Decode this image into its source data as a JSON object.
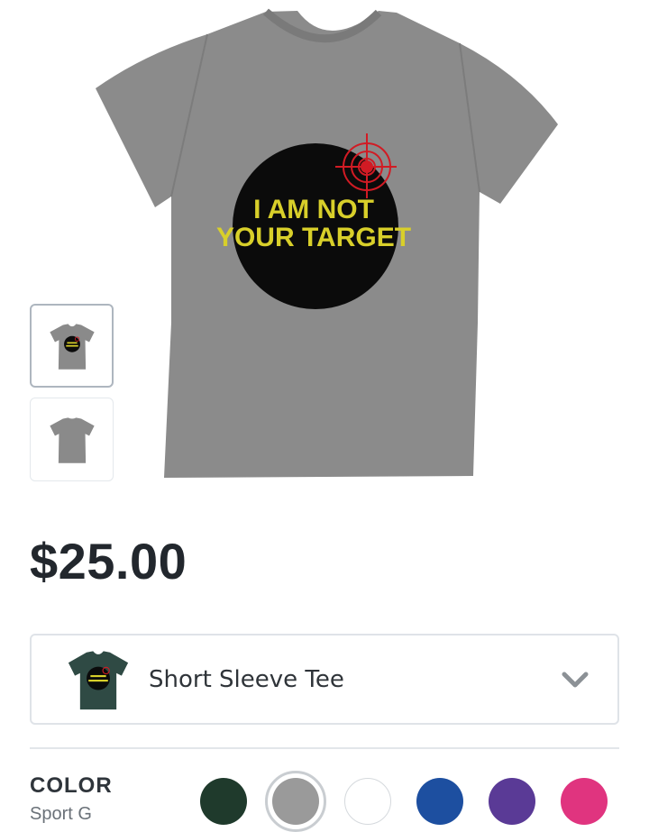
{
  "product": {
    "print_text_line1": "I AM NOT",
    "print_text_line2": "YOUR TARGET",
    "shirt_color": "#8a8a8a",
    "print_circle_color": "#0b0b0b",
    "print_text_color": "#d8cf2a",
    "target_color": "#d11b24"
  },
  "thumbnails": [
    {
      "name": "front",
      "selected": true
    },
    {
      "name": "back",
      "selected": false
    }
  ],
  "price": "$25.00",
  "product_type": {
    "label": "Short Sleeve Tee",
    "icon": "chevron-down-icon",
    "preview_shirt_color": "#2f4a44"
  },
  "color": {
    "label": "COLOR",
    "selected_name": "Sport G",
    "swatches": [
      {
        "color": "#1f3a2c",
        "selected": false
      },
      {
        "color": "#9a9a9a",
        "selected": true
      },
      {
        "color": "#ffffff",
        "selected": false
      },
      {
        "color": "#1d4fa0",
        "selected": false
      },
      {
        "color": "#5a3a96",
        "selected": false
      },
      {
        "color": "#e0347f",
        "selected": false
      }
    ]
  }
}
